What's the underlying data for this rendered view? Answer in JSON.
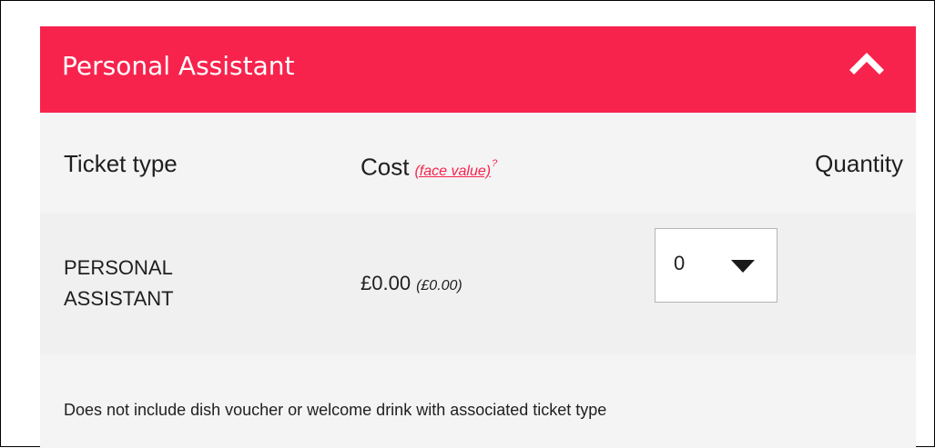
{
  "section": {
    "title": "Personal Assistant",
    "collapse_icon": "chevron-up-icon",
    "header_color": "#f7234d"
  },
  "columns": {
    "ticket_type": "Ticket type",
    "cost": "Cost",
    "face_value_link": "(face value)",
    "face_value_help": "?",
    "quantity": "Quantity"
  },
  "tickets": [
    {
      "name": "PERSONAL ASSISTANT",
      "price": "£0.00",
      "face_value": "(£0.00)",
      "quantity_selected": "0",
      "dropdown_icon": "caret-down-icon"
    }
  ],
  "note": "Does not include dish voucher or welcome drink with associated ticket type"
}
